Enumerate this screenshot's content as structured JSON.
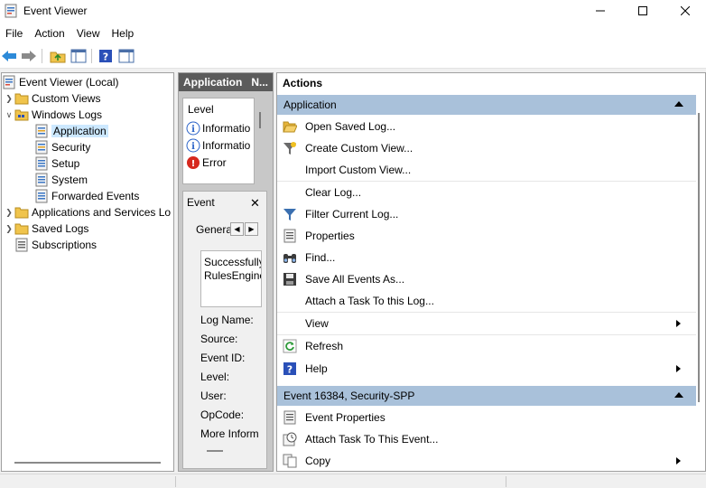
{
  "window": {
    "title": "Event Viewer",
    "min_glyph": "—",
    "max_glyph": "☐",
    "close_glyph": "✕"
  },
  "menu": [
    "File",
    "Action",
    "View",
    "Help"
  ],
  "tree": {
    "root": "Event Viewer (Local)",
    "custom_views": "Custom Views",
    "windows_logs": "Windows Logs",
    "application": "Application",
    "security": "Security",
    "setup": "Setup",
    "system": "System",
    "forwarded": "Forwarded Events",
    "apps_services": "Applications and Services Lo",
    "saved_logs": "Saved Logs",
    "subscriptions": "Subscriptions"
  },
  "middle": {
    "header": "Application",
    "header_more": "N...",
    "level_col": "Level",
    "rows": [
      "Informatio",
      "Informatio",
      "Error"
    ],
    "event_title": "Event",
    "close_glyph": "✕",
    "tab_general": "General",
    "desc_line1": "Successfully",
    "desc_line2": "RulesEngine",
    "fields": [
      "Log Name:",
      "Source:",
      "Event ID:",
      "Level:",
      "User:",
      "OpCode:",
      "More Inform"
    ]
  },
  "actions": {
    "title": "Actions",
    "section1": "Application",
    "items1": [
      "Open Saved Log...",
      "Create Custom View...",
      "Import Custom View...",
      "Clear Log...",
      "Filter Current Log...",
      "Properties",
      "Find...",
      "Save All Events As...",
      "Attach a Task To this Log...",
      "View",
      "Refresh",
      "Help"
    ],
    "section2": "Event 16384, Security-SPP",
    "items2": [
      "Event Properties",
      "Attach Task To This Event...",
      "Copy"
    ]
  },
  "colors": {
    "section_header": "#a9c1da",
    "selection": "#cce8ff",
    "mid_header": "#5b5b5b"
  }
}
